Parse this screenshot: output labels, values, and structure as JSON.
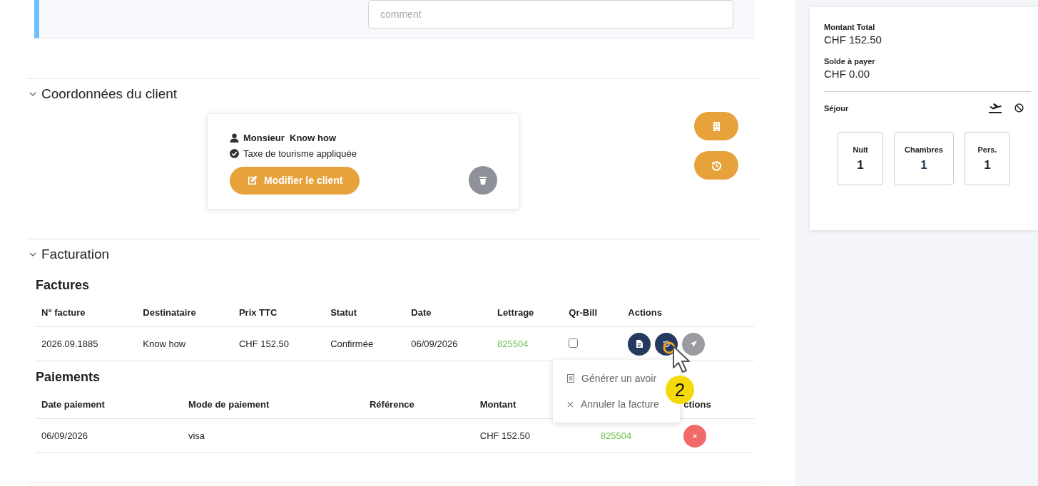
{
  "comment_field": {
    "placeholder": "comment"
  },
  "client_section": {
    "title": "Coordonnées du client",
    "expanded": true,
    "client": {
      "civility": "Monsieur",
      "name": "Know how",
      "tourist_tax": "Taxe de tourisme appliquée",
      "edit_button": "Modifier le client"
    }
  },
  "billing_section": {
    "title": "Facturation",
    "expanded": true,
    "invoices": {
      "title": "Factures",
      "columns": [
        "N° facture",
        "Destinataire",
        "Prix TTC",
        "Statut",
        "Date",
        "Lettrage",
        "Qr-Bill",
        "Actions"
      ],
      "rows": [
        {
          "number": "2026.09.1885",
          "recipient": "Know how",
          "price": "CHF 152.50",
          "status": "Confirmée",
          "date": "06/09/2026",
          "lettering": "825504",
          "qr_bill_checked": false
        }
      ]
    },
    "payments": {
      "title": "Paiements",
      "columns": [
        "Date paiement",
        "Mode de paiement",
        "Référence",
        "Montant",
        "",
        "ctions"
      ],
      "rows": [
        {
          "date": "06/09/2026",
          "mode": "visa",
          "reference": "",
          "amount": "CHF 152.50",
          "lettering": "825504"
        }
      ]
    }
  },
  "menu": {
    "items": [
      {
        "kind": "document",
        "label": "Générer un avoir"
      },
      {
        "kind": "cancel",
        "label": "Annuler la facture"
      }
    ]
  },
  "step_badge": "2",
  "summary": {
    "total_label": "Montant Total",
    "total": "CHF 152.50",
    "balance_label": "Solde à payer",
    "balance": "CHF 0.00",
    "stay_label": "Séjour",
    "counters": [
      {
        "label": "Nuit",
        "value": "1",
        "highlight": false
      },
      {
        "label": "Chambres",
        "value": "1",
        "highlight": true
      },
      {
        "label": "Pers.",
        "value": "1",
        "highlight": false
      }
    ]
  }
}
